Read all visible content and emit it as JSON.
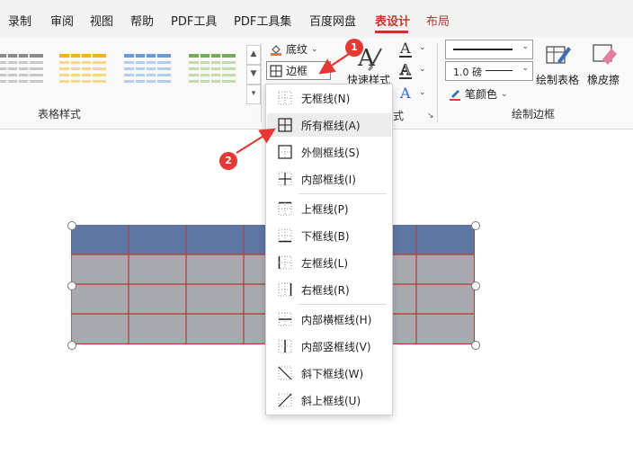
{
  "menu": {
    "items": [
      "录制",
      "审阅",
      "视图",
      "帮助",
      "PDF工具",
      "PDF工具集",
      "百度网盘",
      "表设计",
      "布局"
    ],
    "active": "表设计",
    "active_color": "#c0392b"
  },
  "ribbon": {
    "table_styles_label": "表格样式",
    "shading_label": "底纹",
    "borders_label": "边框",
    "quick_styles_label": "快速样式",
    "art_styles_label_fragment": "式",
    "line_weight_value": "1.0 磅",
    "pen_color_label": "笔颜色",
    "draw_table_label": "绘制表格",
    "eraser_label": "橡皮擦",
    "draw_borders_label": "绘制边框",
    "style_colors": [
      "#8c8c8c",
      "#f0b323",
      "#6a9bd8",
      "#79a95a"
    ],
    "icons": [
      "shading-bucket-icon",
      "borders-grid-icon",
      "quick-styles-a-icon",
      "text-fill-a-icon",
      "text-outline-a-icon",
      "text-effects-a-icon",
      "pen-color-icon",
      "draw-table-pencil-icon",
      "eraser-icon"
    ]
  },
  "border_menu": {
    "items": [
      {
        "label": "无框线(N)",
        "icon": "no-border-icon"
      },
      {
        "label": "所有框线(A)",
        "icon": "all-borders-icon",
        "hover": true
      },
      {
        "label": "外侧框线(S)",
        "icon": "outside-borders-icon"
      },
      {
        "label": "内部框线(I)",
        "icon": "inside-borders-icon"
      },
      {
        "label": "上框线(P)",
        "icon": "top-border-icon"
      },
      {
        "label": "下框线(B)",
        "icon": "bottom-border-icon"
      },
      {
        "label": "左框线(L)",
        "icon": "left-border-icon"
      },
      {
        "label": "右框线(R)",
        "icon": "right-border-icon"
      },
      {
        "label": "内部横框线(H)",
        "icon": "inside-horizontal-border-icon"
      },
      {
        "label": "内部竖框线(V)",
        "icon": "inside-vertical-border-icon"
      },
      {
        "label": "斜下框线(W)",
        "icon": "diagonal-down-border-icon"
      },
      {
        "label": "斜上框线(U)",
        "icon": "diagonal-up-border-icon"
      }
    ]
  },
  "badges": [
    "1",
    "2"
  ],
  "table": {
    "header_color": "#5f76a2",
    "body_color": "#a8aab0",
    "grid_color": "#c0392b",
    "rows": 4,
    "cols": 7
  }
}
